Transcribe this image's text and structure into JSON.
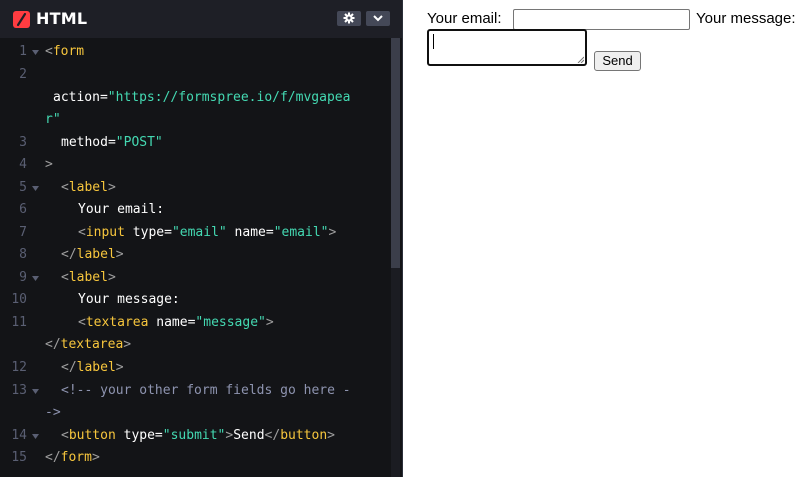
{
  "editor": {
    "title": "HTML",
    "lang_icon": "codepen-slash-icon",
    "settings_icon": "gear-icon",
    "collapse_icon": "chevron-down-icon",
    "line_numbers": [
      "1",
      "2",
      "3",
      "4",
      "5",
      "6",
      "7",
      "8",
      "9",
      "10",
      "11",
      "12",
      "13",
      "14",
      "15"
    ],
    "code": {
      "l1_open": "<",
      "l1_tag": "form",
      "l2_attr": "action=",
      "l2_val_a": "\"https://formspree.io/f/mvgapea",
      "l2_val_b": "r\"",
      "l3_attr": "method=",
      "l3_val": "\"POST\"",
      "l4_close": ">",
      "l5_open": "<",
      "l5_tag": "label",
      "l5_close": ">",
      "l6_text": "Your email:",
      "l7_open": "<",
      "l7_tag": "input",
      "l7_attr1": " type=",
      "l7_val1": "\"email\"",
      "l7_attr2": " name=",
      "l7_val2": "\"email\"",
      "l7_close": ">",
      "l8_open": "</",
      "l8_tag": "label",
      "l8_close": ">",
      "l9_open": "<",
      "l9_tag": "label",
      "l9_close": ">",
      "l10_text": "Your message:",
      "l11_open": "<",
      "l11_tag": "textarea",
      "l11_attr": " name=",
      "l11_val": "\"message\"",
      "l11_close": ">",
      "l11b_open": "</",
      "l11b_tag": "textarea",
      "l11b_close": ">",
      "l12_open": "</",
      "l12_tag": "label",
      "l12_close": ">",
      "l13_a": "<!-- your other form fields go here -",
      "l13_b": "->",
      "l14_open": "<",
      "l14_tag": "button",
      "l14_attr": " type=",
      "l14_val": "\"submit\"",
      "l14_gt": ">",
      "l14_text": "Send",
      "l14_close_open": "</",
      "l14_close_tag": "button",
      "l14_close": ">",
      "l15_open": "</",
      "l15_tag": "form",
      "l15_close": ">"
    }
  },
  "preview": {
    "email_label": "Your email:",
    "email_value": "",
    "message_label": "Your message:",
    "message_value": "",
    "send_label": "Send"
  }
}
